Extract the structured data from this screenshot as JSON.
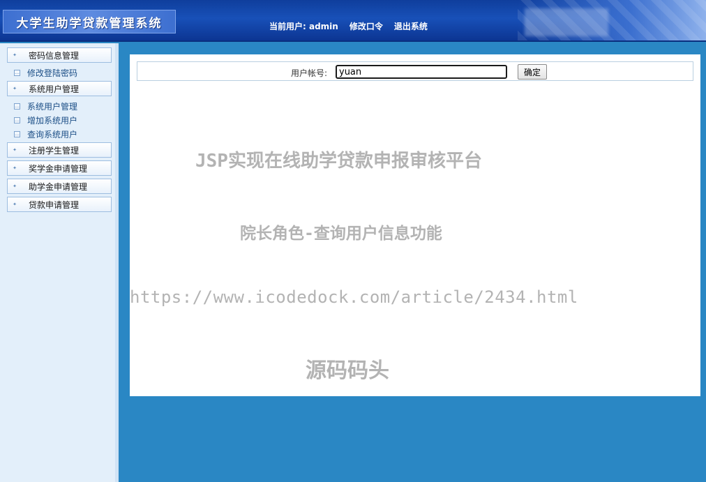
{
  "header": {
    "title": "大学生助学贷款管理系统",
    "current_user_label": "当前用户: admin",
    "change_password": "修改口令",
    "logout": "退出系统"
  },
  "sidebar": {
    "groups": [
      {
        "label": "密码信息管理",
        "items": [
          "修改登陆密码"
        ]
      },
      {
        "label": "系统用户管理",
        "items": [
          "系统用户管理",
          "增加系统用户",
          "查询系统用户"
        ]
      },
      {
        "label": "注册学生管理",
        "items": []
      },
      {
        "label": "奖学金申请管理",
        "items": []
      },
      {
        "label": "助学金申请管理",
        "items": []
      },
      {
        "label": "贷款申请管理",
        "items": []
      }
    ]
  },
  "search": {
    "label": "用户帐号:",
    "value": "yuan",
    "button_label": "确定"
  },
  "overlay": {
    "line1": "JSP实现在线助学贷款申报审核平台",
    "line2": "院长角色-查询用户信息功能",
    "line3": "https://www.icodedock.com/article/2434.html",
    "line4": "源码码头"
  },
  "colors": {
    "background": "#2a87c4",
    "header": "#1850b8",
    "sidebar": "#e3effa",
    "link": "#1b4e86"
  }
}
